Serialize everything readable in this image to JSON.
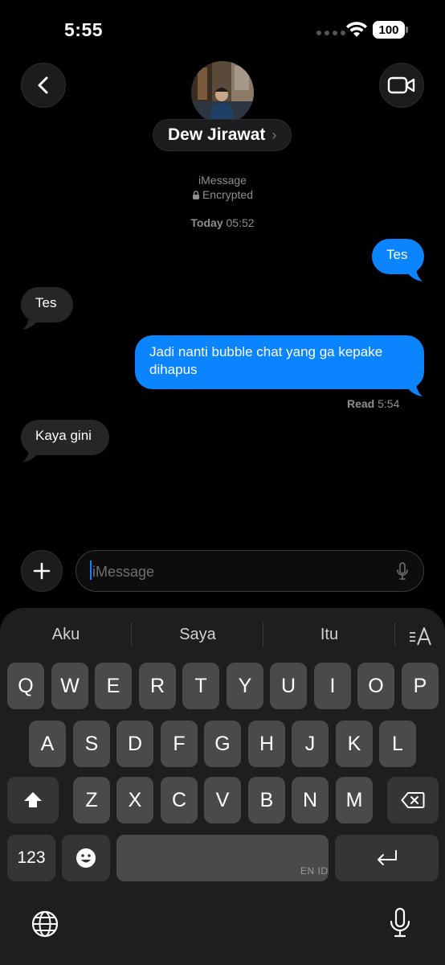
{
  "status": {
    "time": "5:55",
    "battery": "100"
  },
  "contact": {
    "name": "Dew Jirawat",
    "chevron": "›"
  },
  "thread": {
    "service": "iMessage",
    "encrypted": "Encrypted",
    "date_label": "Today",
    "date_time": "05:52"
  },
  "messages": [
    {
      "direction": "outgoing",
      "text": "Tes"
    },
    {
      "direction": "incoming",
      "text": "Tes"
    },
    {
      "direction": "outgoing",
      "text": "Jadi nanti bubble chat yang ga kepake dihapus"
    },
    {
      "direction": "incoming",
      "text": "Kaya gini"
    }
  ],
  "receipt": {
    "label": "Read",
    "time": "5:54"
  },
  "composer": {
    "placeholder": "iMessage"
  },
  "keyboard": {
    "suggestions": [
      "Aku",
      "Saya",
      "Itu"
    ],
    "row1": [
      "Q",
      "W",
      "E",
      "R",
      "T",
      "Y",
      "U",
      "I",
      "O",
      "P"
    ],
    "row2": [
      "A",
      "S",
      "D",
      "F",
      "G",
      "H",
      "J",
      "K",
      "L"
    ],
    "row3": [
      "Z",
      "X",
      "C",
      "V",
      "B",
      "N",
      "M"
    ],
    "numbers_key": "123",
    "language_label": "EN ID"
  },
  "colors": {
    "outgoing_bubble": "#0a84ff",
    "incoming_bubble": "#262628",
    "background": "#000000"
  }
}
